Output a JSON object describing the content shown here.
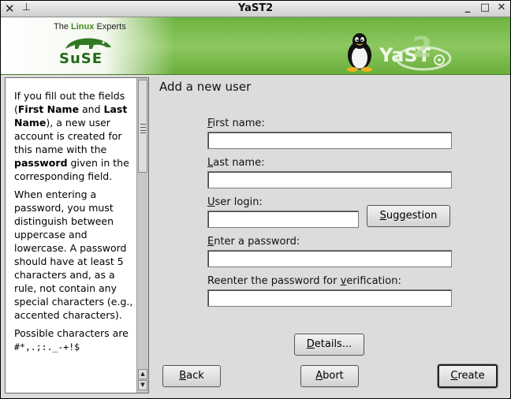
{
  "window": {
    "title": "YaST2",
    "close_glyph": "✕",
    "pin_glyph": "⊥",
    "minimize_glyph": "_",
    "maximize_glyph": "□",
    "close_btn_glyph": "✕"
  },
  "banner": {
    "tagline_prefix": "The",
    "tagline_brand": "Linux",
    "tagline_suffix": "Experts",
    "logo_text": "SuSE",
    "product_text": "YaST",
    "product_version": "2",
    "icons": [
      "chameleon-icon",
      "tux-penguin-icon"
    ],
    "brand_color": "#6db33f"
  },
  "help": {
    "p1_a": "If you fill out the fields (",
    "p1_first": "First Name",
    "p1_and": " and ",
    "p1_last": "Last Name",
    "p1_b": "), a new user account is created for this name with the ",
    "p1_password": "password",
    "p1_c": " given in the corresponding field.",
    "p2": "When entering a password, you must distinguish between uppercase and lowercase. A password should have at least 5 characters and, as a rule, not contain any special characters (e.g., accented characters).",
    "p3_a": "Possible characters are ",
    "p3_code": "#*,.;:._-+!$"
  },
  "form": {
    "title": "Add a new user",
    "first_name_key": "F",
    "first_name_rest": "irst name:",
    "first_name_value": "",
    "last_name_key": "L",
    "last_name_rest": "ast name:",
    "last_name_value": "",
    "login_key": "U",
    "login_rest": "ser login:",
    "login_value": "",
    "suggestion_key": "S",
    "suggestion_rest": "uggestion",
    "password_key": "E",
    "password_rest": "nter a password:",
    "password_value": "",
    "reenter_a": "Reenter the password for ",
    "reenter_key": "v",
    "reenter_b": "erification:",
    "reenter_value": "",
    "details_key": "D",
    "details_rest": "etails..."
  },
  "footer": {
    "back_key": "B",
    "back_rest": "ack",
    "abort_key": "A",
    "abort_rest": "bort",
    "create_key": "C",
    "create_rest": "reate"
  }
}
